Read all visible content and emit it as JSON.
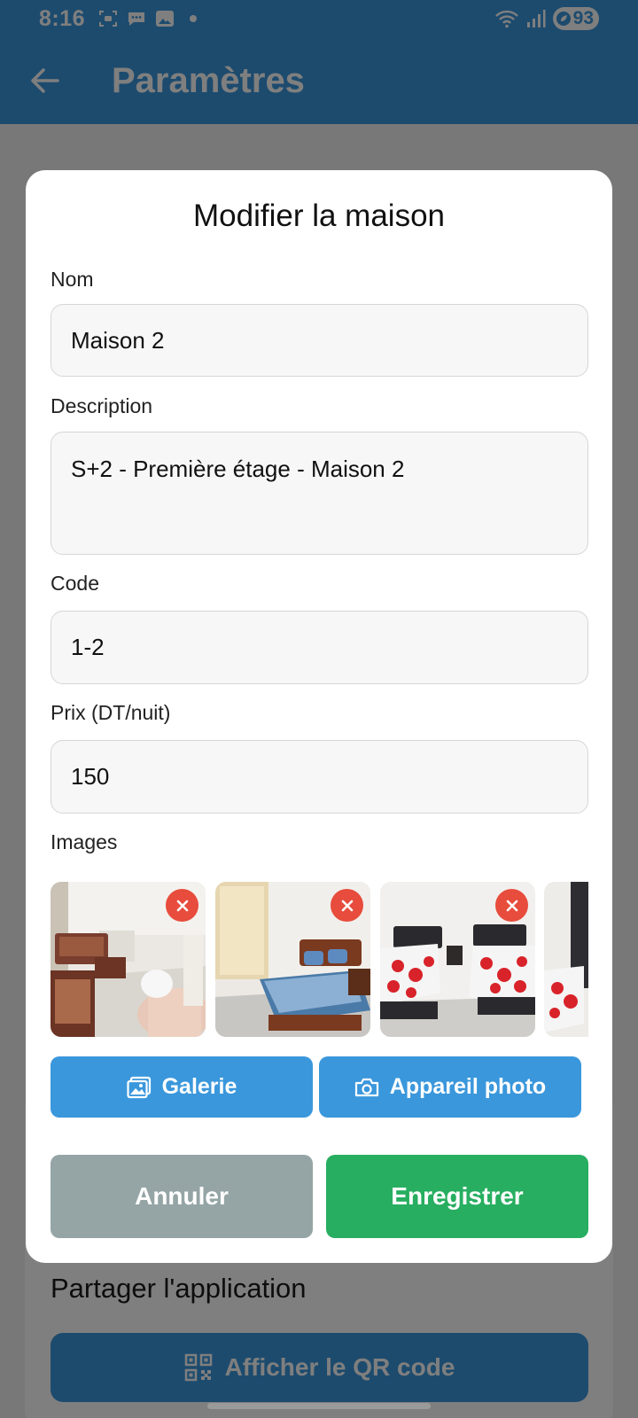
{
  "status_bar": {
    "time": "8:16",
    "battery": "93",
    "icons": [
      "screenshot-icon",
      "message-icon",
      "image-icon",
      "wifi-icon",
      "signal-icon",
      "battery-icon"
    ]
  },
  "app_bar": {
    "title": "Paramètres"
  },
  "background": {
    "share_title": "Partager l'application",
    "qr_button_label": "Afficher le QR code"
  },
  "dialog": {
    "title": "Modifier la maison",
    "fields": {
      "name_label": "Nom",
      "name_value": "Maison 2",
      "description_label": "Description",
      "description_value": "S+2 - Première étage - Maison 2",
      "code_label": "Code",
      "code_value": "1-2",
      "price_label": "Prix (DT/nuit)",
      "price_value": "150"
    },
    "images_label": "Images",
    "images": [
      {
        "alt": "living-room"
      },
      {
        "alt": "double-bedroom"
      },
      {
        "alt": "twin-bedroom"
      },
      {
        "alt": "bedroom-partial"
      }
    ],
    "gallery_button": "Galerie",
    "camera_button": "Appareil photo",
    "cancel_button": "Annuler",
    "save_button": "Enregistrer"
  },
  "colors": {
    "primary": "#3a97dc",
    "cancel": "#95a5a6",
    "save": "#27ae60",
    "remove": "#e74c3c"
  }
}
